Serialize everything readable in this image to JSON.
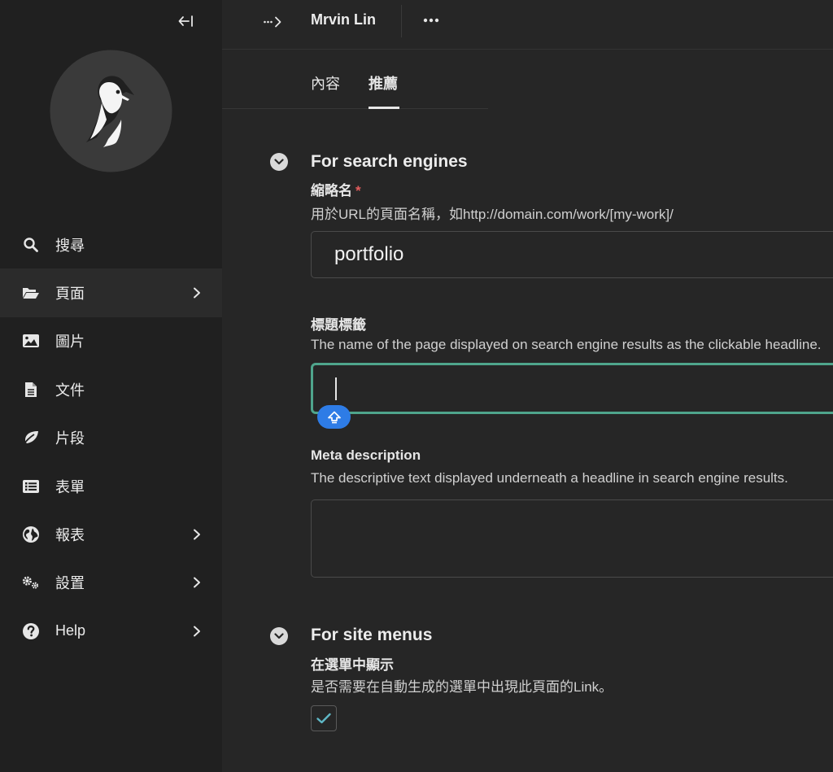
{
  "sidebar": {
    "items": [
      {
        "label": "搜尋",
        "icon": "search-icon"
      },
      {
        "label": "頁面",
        "icon": "folder-open-icon",
        "active": true,
        "has_submenu": true
      },
      {
        "label": "圖片",
        "icon": "image-icon"
      },
      {
        "label": "文件",
        "icon": "document-icon"
      },
      {
        "label": "片段",
        "icon": "leaf-icon"
      },
      {
        "label": "表單",
        "icon": "list-icon"
      },
      {
        "label": "報表",
        "icon": "globe-icon",
        "has_submenu": true
      },
      {
        "label": "設置",
        "icon": "cogs-icon",
        "has_submenu": true
      },
      {
        "label": "Help",
        "icon": "help-icon",
        "has_submenu": true
      }
    ]
  },
  "header": {
    "page_name": "Mrvin Lin"
  },
  "tabs": [
    {
      "label": "內容",
      "active": false
    },
    {
      "label": "推薦",
      "active": true
    }
  ],
  "sections": {
    "search": {
      "title": "For search engines",
      "slug": {
        "label": "縮略名",
        "required_mark": "*",
        "help": "用於URL的頁面名稱，如http://domain.com/work/[my-work]/",
        "value": "portfolio"
      },
      "seo_title": {
        "label": "標題標籤",
        "help": "The name of the page displayed on search engine results as the clickable headline.",
        "value": ""
      },
      "meta_description": {
        "label": "Meta description",
        "help": "The descriptive text displayed underneath a headline in search engine results.",
        "value": ""
      }
    },
    "menus": {
      "title": "For site menus",
      "show_in_menus": {
        "label": "在選單中顯示",
        "help": "是否需要在自動生成的選單中出現此頁面的Link。",
        "checked": true
      }
    }
  },
  "colors": {
    "sidebar_bg": "#202020",
    "main_bg": "#262626",
    "focus_border": "#4fa58c",
    "required": "#e25c5c",
    "caps_badge": "#2e7ce6",
    "check": "#5fb8c6"
  }
}
